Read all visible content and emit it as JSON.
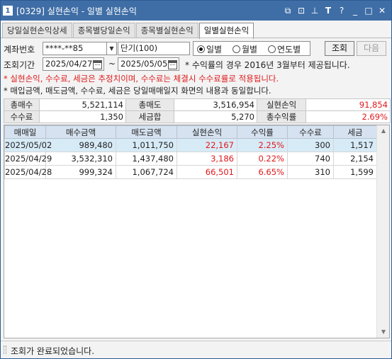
{
  "window": {
    "number": "1",
    "title": "[0329] 실현손익 - 일별 실현손익",
    "icons": [
      "window-copy-icon",
      "window-link-icon",
      "pin-icon",
      "font-size-icon",
      "help-icon",
      "minimize-icon",
      "maximize-icon",
      "close-icon"
    ]
  },
  "tabs": [
    {
      "label": "당일실현손익상세"
    },
    {
      "label": "종목별당일손익"
    },
    {
      "label": "종목별실현손익"
    },
    {
      "label": "일별실현손익"
    }
  ],
  "form": {
    "account_label": "계좌번호",
    "account_value": "****-**85",
    "account_type": "단기(100)",
    "period_label": "조회기간",
    "date_from": "2025/04/27",
    "tilde": "~",
    "date_to": "2025/05/05",
    "period_note": "* 수익률의 경우 2016년 3월부터 제공됩니다.",
    "radio_daily": "일별",
    "radio_monthly": "월별",
    "radio_yearly": "연도별",
    "query_button": "조회",
    "next_button": "다음"
  },
  "notes": {
    "red": "* 실현손익, 수수료, 세금은 추정치이며, 수수료는 체결시 수수료률로 적용됩니다.",
    "black": "* 매입금액, 매도금액, 수수료, 세금은 당일매매일지 화면의 내용과 동일합니다."
  },
  "summary": {
    "row1": [
      {
        "label": "총매수",
        "value": "5,521,114"
      },
      {
        "label": "총매도",
        "value": "3,516,954"
      },
      {
        "label": "실현손익",
        "value": "91,854"
      }
    ],
    "row2": [
      {
        "label": "수수료",
        "value": "1,350"
      },
      {
        "label": "세금합",
        "value": "5,270"
      },
      {
        "label": "총수익률",
        "value": "2.69%"
      }
    ]
  },
  "grid": {
    "columns": [
      "매매일",
      "매수금액",
      "매도금액",
      "실현손익",
      "수익률",
      "수수료",
      "세금"
    ],
    "rows": [
      {
        "date": "2025/05/02",
        "buy": "989,480",
        "sell": "1,011,750",
        "pnl": "22,167",
        "rate": "2.25%",
        "fee": "300",
        "tax": "1,517"
      },
      {
        "date": "2025/04/29",
        "buy": "3,532,310",
        "sell": "1,437,480",
        "pnl": "3,186",
        "rate": "0.22%",
        "fee": "740",
        "tax": "2,154"
      },
      {
        "date": "2025/04/28",
        "buy": "999,324",
        "sell": "1,067,724",
        "pnl": "66,501",
        "rate": "6.65%",
        "fee": "310",
        "tax": "1,599"
      }
    ]
  },
  "status": {
    "message": "조회가 완료되었습니다."
  },
  "colors": {
    "titlebar": "#3f6ea6",
    "positive": "#e0191b",
    "selected_row": "#d7ebf7",
    "grid_header": "#d6e2f0"
  }
}
